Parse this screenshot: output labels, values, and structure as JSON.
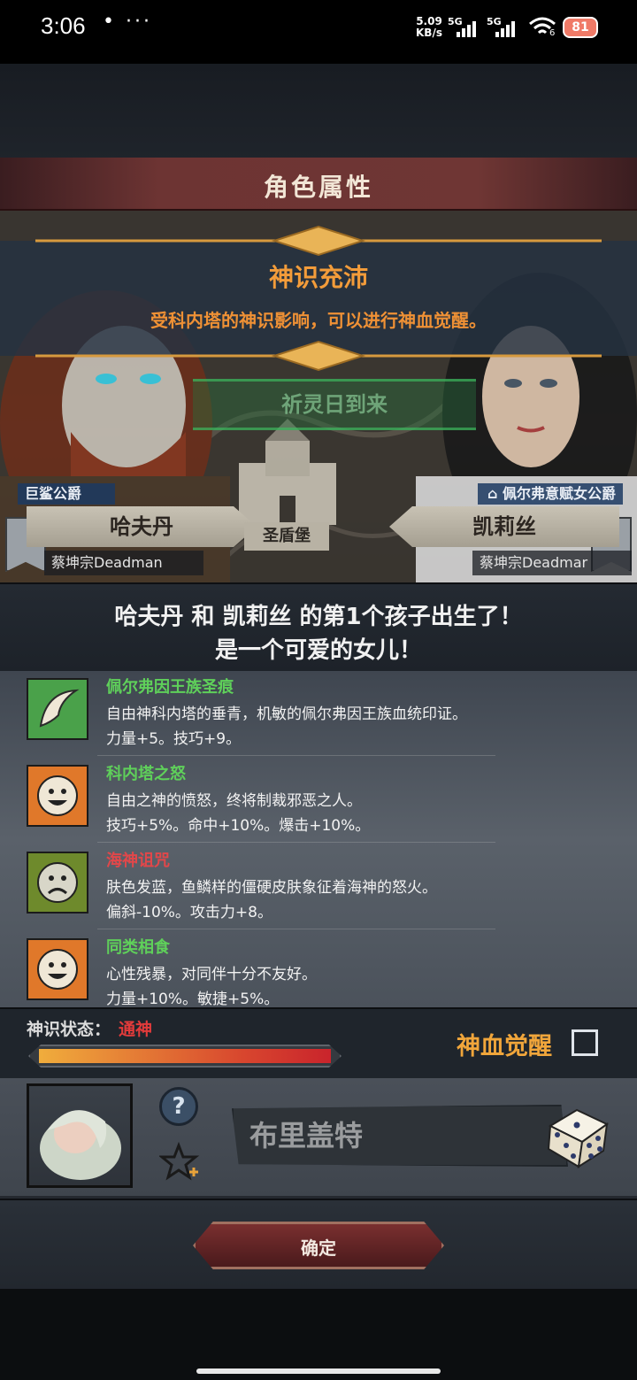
{
  "status_bar": {
    "time": "3:06",
    "dots": "• ···",
    "speed_value": "5.09",
    "speed_unit": "KB/s",
    "sim1_label": "5G",
    "sim2_label": "5G",
    "wifi_badge": "6",
    "battery": "81"
  },
  "header": {
    "title": "角色属性"
  },
  "notice": {
    "title": "神识充沛",
    "message": "受科内塔的神识影响，可以进行神血觉醒。"
  },
  "event_button": {
    "label": "祈灵日到来"
  },
  "map_text": {
    "castle": "圣盾堡",
    "faded_top": "圣盾堡"
  },
  "father": {
    "title": "巨鲨公爵",
    "name": "哈夫丹",
    "house": "蔡坤宗Deadman"
  },
  "mother": {
    "title": "佩尔弗意赋女公爵",
    "name": "凯莉丝",
    "house": "蔡坤宗Deadmar"
  },
  "birth": {
    "line1": "哈夫丹 和 凯莉丝 的第1个孩子出生了！",
    "line2": "是一个可爱的女儿！"
  },
  "traits": [
    {
      "name": "佩尔弗因王族圣痕",
      "name_color": "#5fd05a",
      "icon": "feather-icon",
      "icon_bg": "#4aa14a",
      "desc": "自由神科内塔的垂青，机敏的佩尔弗因王族血统印证。",
      "stats": "力量+5。技巧+9。"
    },
    {
      "name": "科内塔之怒",
      "name_color": "#5fd05a",
      "icon": "happy-face-icon",
      "icon_bg": "#e0782a",
      "desc": "自由之神的愤怒，终将制裁邪恶之人。",
      "stats": "技巧+5%。命中+10%。爆击+10%。"
    },
    {
      "name": "海神诅咒",
      "name_color": "#e2474a",
      "icon": "sad-face-icon",
      "icon_bg": "#6e8a2c",
      "desc": "肤色发蓝，鱼鳞样的僵硬皮肤象征着海神的怒火。",
      "stats": "偏斜-10%。攻击力+8。"
    },
    {
      "name": "同类相食",
      "name_color": "#5fd05a",
      "icon": "happy-face-icon",
      "icon_bg": "#e0782a",
      "desc": "心性残暴，对同伴十分不友好。",
      "stats": "力量+10%。敏捷+5%。"
    }
  ],
  "divine_status": {
    "label": "神识状态：",
    "value": "通神",
    "progress": 1.0,
    "awaken_label": "神血觉醒",
    "awaken_checked": false
  },
  "child": {
    "name": "布里盖特",
    "help_icon": "question-icon",
    "fav_icon": "star-plus-icon",
    "dice_icon": "dice-icon"
  },
  "footer": {
    "confirm_label": "确定"
  },
  "colors": {
    "accent_orange": "#f39c3a",
    "danger_red": "#e2474a",
    "positive_green": "#5fd05a"
  }
}
